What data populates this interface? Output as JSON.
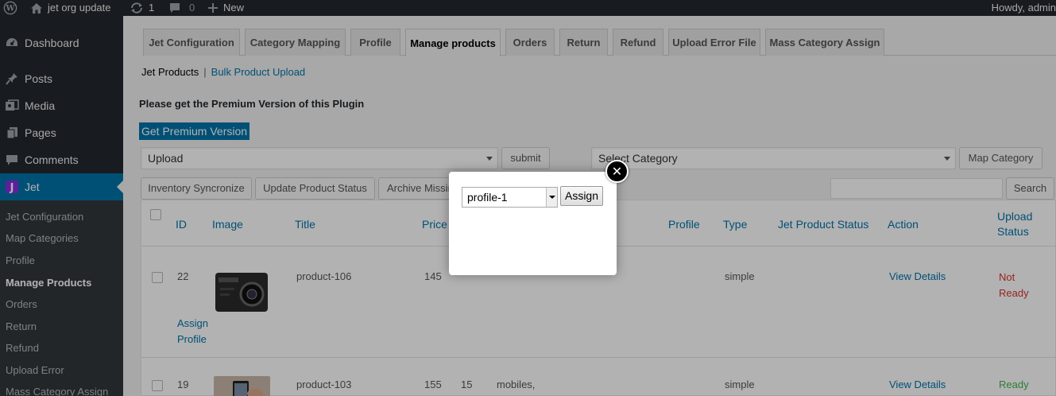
{
  "adminbar": {
    "site_name": "jet org update",
    "updates_count": "1",
    "comments_count": "0",
    "new_label": "New",
    "howdy": "Howdy, admin"
  },
  "sidebar": {
    "menu": [
      {
        "label": "Dashboard",
        "icon": "dashboard-icon"
      },
      {
        "label": "Posts",
        "icon": "pin-icon"
      },
      {
        "label": "Media",
        "icon": "media-icon"
      },
      {
        "label": "Pages",
        "icon": "pages-icon"
      },
      {
        "label": "Comments",
        "icon": "comment-icon"
      },
      {
        "label": "Jet",
        "icon": "jet-logo-icon"
      }
    ],
    "submenu": [
      {
        "label": "Jet Configuration"
      },
      {
        "label": "Map Categories"
      },
      {
        "label": "Profile"
      },
      {
        "label": "Manage Products"
      },
      {
        "label": "Orders"
      },
      {
        "label": "Return"
      },
      {
        "label": "Refund"
      },
      {
        "label": "Upload Error"
      },
      {
        "label": "Mass Category Assign"
      }
    ]
  },
  "tabs": [
    "Jet Configuration",
    "Category Mapping",
    "Profile",
    "Manage products",
    "Orders",
    "Return",
    "Refund",
    "Upload Error File",
    "Mass Category Assign"
  ],
  "subnav": {
    "current": "Jet Products",
    "separator": "|",
    "link": "Bulk Product Upload"
  },
  "premium": {
    "notice": "Please get the Premium Version of this Plugin",
    "button": "Get Premium Version"
  },
  "actions": {
    "upload_select": "Upload",
    "submit": "submit",
    "category_select": "Select Category",
    "map_category": "Map Category",
    "inventory_sync": "Inventory Syncronize",
    "update_status": "Update Product Status",
    "archive_missing": "Archive Missing",
    "search": "Search"
  },
  "table": {
    "headers": {
      "id": "ID",
      "image": "Image",
      "title": "Title",
      "price": "Price",
      "profile": "Profile",
      "type": "Type",
      "jet_status": "Jet Product Status",
      "action": "Action",
      "upload_status_1": "Upload",
      "upload_status_2": "Status"
    },
    "rows": [
      {
        "id": "22",
        "title": "product-106",
        "price": "145",
        "qty": "",
        "categories": "",
        "type": "simple",
        "action": "View Details",
        "status_1": "Not",
        "status_2": "Ready",
        "assign_1": "Assign",
        "assign_2": "Profile"
      },
      {
        "id": "19",
        "title": "product-103",
        "price": "155",
        "qty": "15",
        "categories": "mobiles,",
        "type": "simple",
        "action": "View Details",
        "status_1": "Ready"
      }
    ]
  },
  "modal": {
    "select_value": "profile-1",
    "assign_button": "Assign",
    "close_icon": "close-icon",
    "close_glyph": "✕"
  }
}
